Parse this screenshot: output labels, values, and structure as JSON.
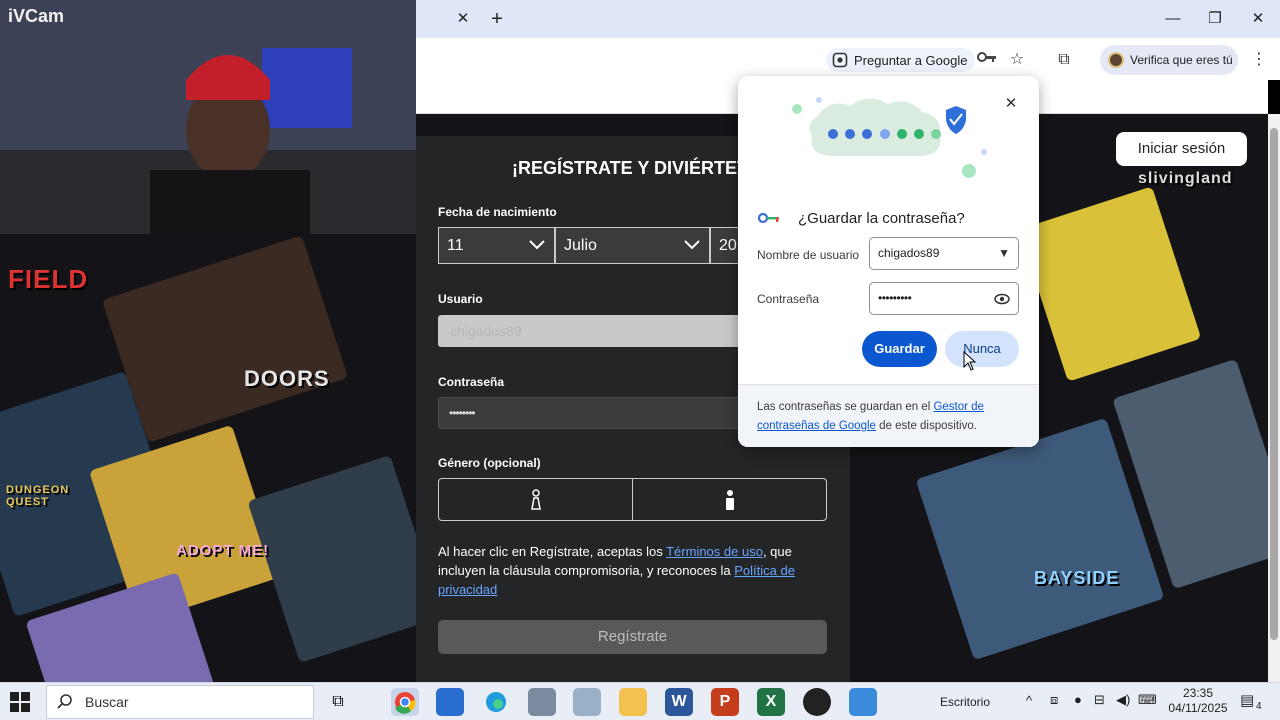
{
  "webcam": {
    "label": "iVCam"
  },
  "browser": {
    "tab_close_icon": "close-icon",
    "new_tab_icon": "plus-icon",
    "ask_google": "Preguntar a Google",
    "verify_label": "Verifica que eres tú"
  },
  "background_logos": [
    "FIELD",
    "DOORS",
    "DUNGEON QUEST",
    "ADOPT ME!",
    "BAYSIDE",
    "slivingland"
  ],
  "page": {
    "login_button": "Iniciar sesión",
    "title": "¡REGÍSTRATE Y DIVIÉRTET",
    "dob_label": "Fecha de nacimiento",
    "dob": {
      "day": "11",
      "month": "Julio",
      "year": "20"
    },
    "username_label": "Usuario",
    "username_value": "chigados89",
    "password_label": "Contraseña",
    "password_value": "••••••••",
    "gender_label": "Género (opcional)",
    "legal": {
      "part1": "Al hacer clic en Regístrate, aceptas los ",
      "terms": "Términos de uso",
      "part2": ", que incluyen la cláusula compromisoria, y reconoces la ",
      "privacy": "Política de privacidad"
    },
    "register_button": "Regístrate"
  },
  "password_popup": {
    "title": "¿Guardar la contraseña?",
    "username_label": "Nombre de usuario",
    "username_value": "chigados89",
    "password_label": "Contraseña",
    "password_value": "•••••••••",
    "save_button": "Guardar",
    "never_button": "Nunca",
    "footer_part1": "Las contraseñas se guardan en el ",
    "footer_link": "Gestor de contraseñas de Google",
    "footer_part2": " de este dispositivo."
  },
  "taskbar": {
    "search_placeholder": "Buscar",
    "desktop_label": "Escritorio",
    "time": "23:35",
    "date": "04/11/2025",
    "notification_count": "4"
  },
  "colors": {
    "primary_button": "#0b57d0",
    "secondary_button": "#d3e3fd",
    "form_bg": "#232527",
    "tabbar": "#dfe6f7"
  }
}
